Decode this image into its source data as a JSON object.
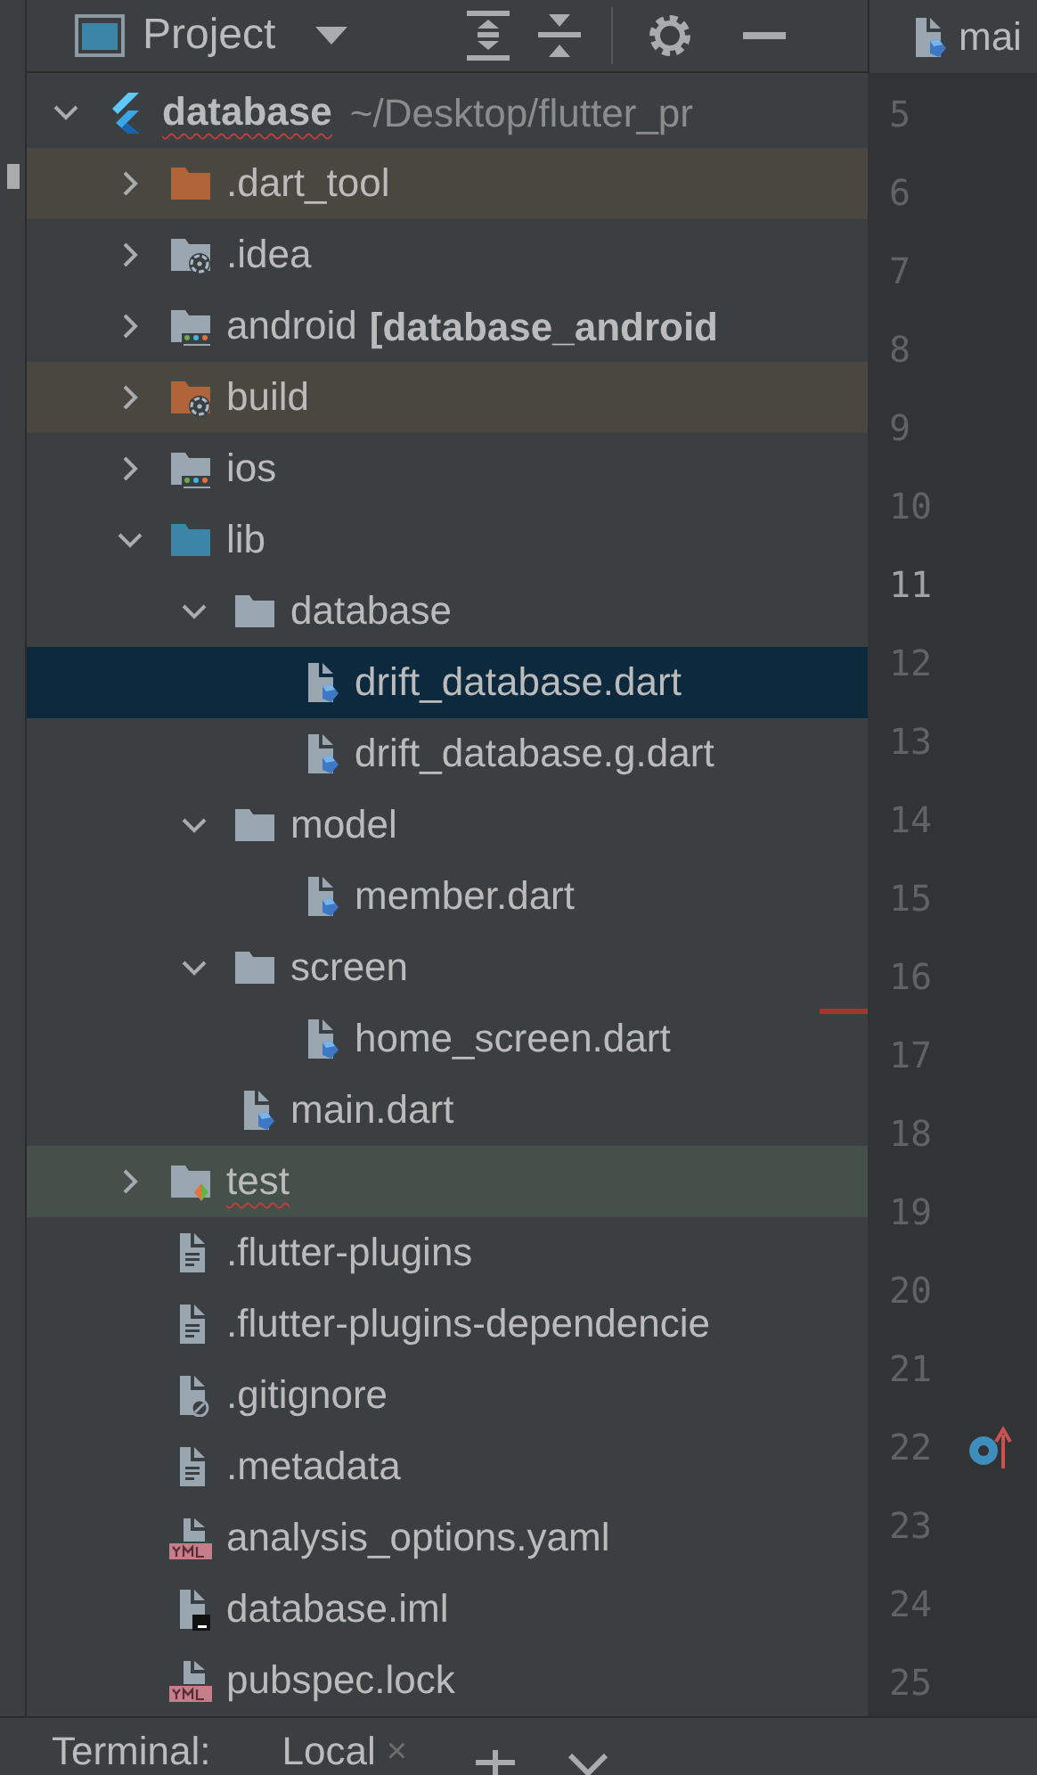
{
  "toolbar": {
    "title": "Project"
  },
  "editor_tab": {
    "label": "mai"
  },
  "tree": [
    {
      "label": "database",
      "path": "~/Desktop/flutter_pr",
      "kind": "flutter",
      "expanded": true,
      "error": true,
      "selected": false,
      "excluded": false,
      "children": [
        {
          "label": ".dart_tool",
          "kind": "folder",
          "expanded": false,
          "excluded": true,
          "selected": false,
          "error": false
        },
        {
          "label": ".idea",
          "kind": "config-folder",
          "expanded": false,
          "excluded": false,
          "selected": false,
          "error": false
        },
        {
          "label": "android",
          "module": "[database_android",
          "kind": "module-folder",
          "expanded": false,
          "excluded": false,
          "selected": false,
          "error": false
        },
        {
          "label": "build",
          "kind": "config-folder",
          "expanded": false,
          "excluded": true,
          "selected": false,
          "error": false
        },
        {
          "label": "ios",
          "kind": "module-folder",
          "expanded": false,
          "excluded": false,
          "selected": false,
          "error": false
        },
        {
          "label": "lib",
          "kind": "source-folder",
          "expanded": true,
          "excluded": false,
          "selected": false,
          "error": false,
          "children": [
            {
              "label": "database",
              "kind": "folder",
              "expanded": true,
              "excluded": false,
              "selected": false,
              "error": false,
              "children": [
                {
                  "label": "drift_database.dart",
                  "kind": "dart",
                  "excluded": false,
                  "selected": true,
                  "error": false
                },
                {
                  "label": "drift_database.g.dart",
                  "kind": "dart",
                  "excluded": false,
                  "selected": false,
                  "error": false
                }
              ]
            },
            {
              "label": "model",
              "kind": "folder",
              "expanded": true,
              "excluded": false,
              "selected": false,
              "error": false,
              "children": [
                {
                  "label": "member.dart",
                  "kind": "dart",
                  "excluded": false,
                  "selected": false,
                  "error": false
                }
              ]
            },
            {
              "label": "screen",
              "kind": "folder",
              "expanded": true,
              "excluded": false,
              "selected": false,
              "error": false,
              "children": [
                {
                  "label": "home_screen.dart",
                  "kind": "dart",
                  "excluded": false,
                  "selected": false,
                  "error": false
                }
              ]
            },
            {
              "label": "main.dart",
              "kind": "dart",
              "excluded": false,
              "selected": false,
              "error": false
            }
          ]
        },
        {
          "label": "test",
          "kind": "test-folder",
          "expanded": false,
          "excluded": false,
          "selected": false,
          "error": true
        },
        {
          "label": ".flutter-plugins",
          "kind": "text",
          "excluded": false,
          "selected": false,
          "error": false
        },
        {
          "label": ".flutter-plugins-dependencie",
          "kind": "text",
          "excluded": false,
          "selected": false,
          "error": false
        },
        {
          "label": ".gitignore",
          "kind": "ignore",
          "excluded": false,
          "selected": false,
          "error": false
        },
        {
          "label": ".metadata",
          "kind": "text",
          "excluded": false,
          "selected": false,
          "error": false
        },
        {
          "label": "analysis_options.yaml",
          "kind": "yml",
          "excluded": false,
          "selected": false,
          "error": false
        },
        {
          "label": "database.iml",
          "kind": "iml",
          "excluded": false,
          "selected": false,
          "error": false
        },
        {
          "label": "pubspec.lock",
          "kind": "yml",
          "excluded": false,
          "selected": false,
          "error": false
        }
      ]
    }
  ],
  "gutter": [
    {
      "number": "5",
      "current": false
    },
    {
      "number": "6",
      "current": false
    },
    {
      "number": "7",
      "current": false
    },
    {
      "number": "8",
      "current": false
    },
    {
      "number": "9",
      "current": false
    },
    {
      "number": "10",
      "current": false
    },
    {
      "number": "11",
      "current": true
    },
    {
      "number": "12",
      "current": false
    },
    {
      "number": "13",
      "current": false
    },
    {
      "number": "14",
      "current": false
    },
    {
      "number": "15",
      "current": false
    },
    {
      "number": "16",
      "current": false
    },
    {
      "number": "17",
      "current": false
    },
    {
      "number": "18",
      "current": false
    },
    {
      "number": "19",
      "current": false
    },
    {
      "number": "20",
      "current": false
    },
    {
      "number": "21",
      "current": false
    },
    {
      "number": "22",
      "current": false,
      "kind": "marker"
    },
    {
      "number": "23",
      "current": false
    },
    {
      "number": "24",
      "current": false
    },
    {
      "number": "25",
      "current": false
    }
  ],
  "bottom_bar": {
    "title": "Terminal:",
    "tab": "Local",
    "tab_close": "×"
  }
}
